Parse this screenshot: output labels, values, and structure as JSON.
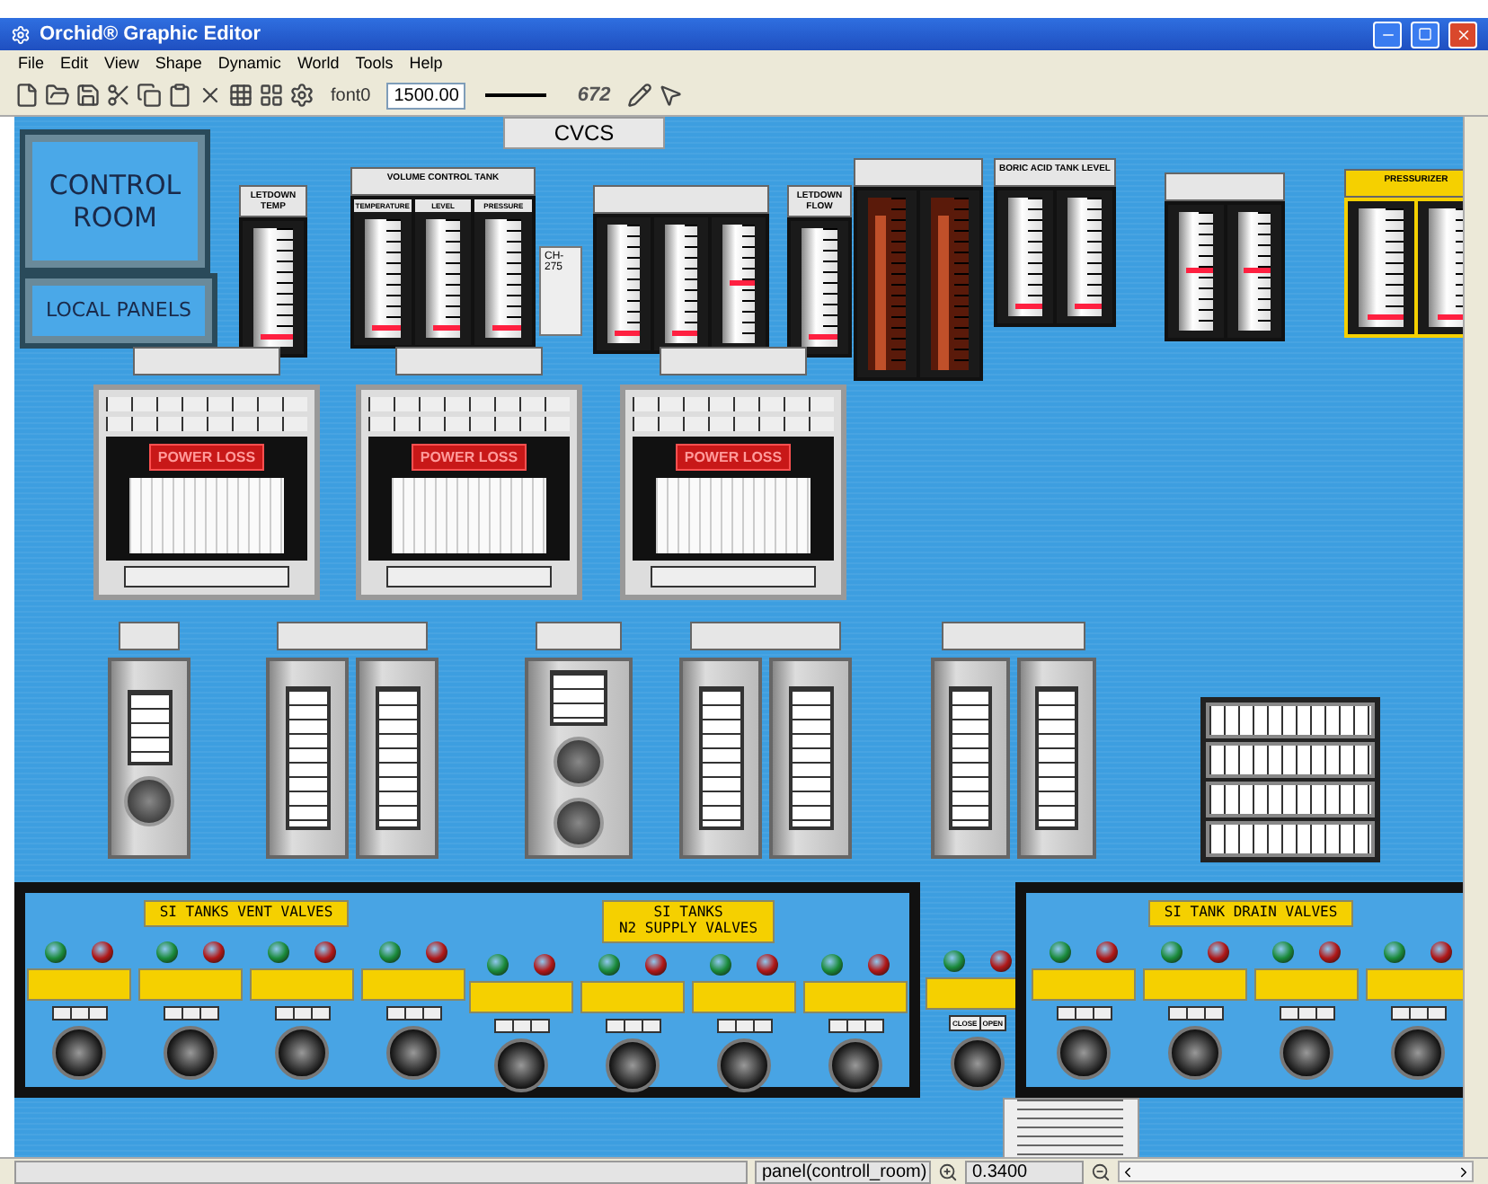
{
  "window": {
    "title": "Orchid® Graphic Editor"
  },
  "menu": [
    "File",
    "Edit",
    "View",
    "Shape",
    "Dynamic",
    "World",
    "Tools",
    "Help"
  ],
  "toolbar": {
    "font": "font0",
    "size": "1500.00",
    "number": "672"
  },
  "canvas": {
    "tab": "CVCS",
    "nav_buttons": [
      "CONTROL ROOM",
      "LOCAL PANELS"
    ],
    "meter_groups": [
      {
        "title": "LETDOWN TEMP",
        "highlight": false,
        "meters": [
          {
            "kind": "vertical",
            "level": 0.08
          }
        ]
      },
      {
        "title": "VOLUME CONTROL TANK",
        "highlight": false,
        "meters": [
          {
            "kind": "vertical",
            "label": "TEMPERATURE",
            "level": 0.08
          },
          {
            "kind": "vertical",
            "label": "LEVEL",
            "level": 0.08
          },
          {
            "kind": "vertical",
            "label": "PRESSURE",
            "level": 0.08
          }
        ]
      },
      {
        "highlight": false,
        "meters": [
          {
            "kind": "vertical",
            "level": 0.08
          },
          {
            "kind": "vertical",
            "level": 0.08
          },
          {
            "kind": "vertical",
            "level": 0.5
          }
        ]
      },
      {
        "title": "LETDOWN FLOW",
        "highlight": false,
        "meters": [
          {
            "kind": "vertical",
            "level": 0.08
          }
        ]
      },
      {
        "highlight": false,
        "meters": [
          {
            "kind": "bar",
            "level": 0.9
          },
          {
            "kind": "bar",
            "level": 0.9
          }
        ]
      },
      {
        "title": "BORIC ACID TANK LEVEL",
        "highlight": false,
        "meters": [
          {
            "kind": "vertical",
            "level": 0.08
          },
          {
            "kind": "vertical",
            "level": 0.08
          }
        ]
      },
      {
        "highlight": false,
        "meters": [
          {
            "kind": "vertical",
            "level": 0.5
          },
          {
            "kind": "vertical",
            "level": 0.5
          }
        ]
      },
      {
        "title": "PRESSURIZER",
        "highlight": true,
        "meters": [
          {
            "kind": "vertical",
            "level": 0.08
          },
          {
            "kind": "vertical",
            "level": 0.08
          }
        ]
      }
    ],
    "note": "CH-275",
    "recorders": [
      {
        "alarm": "POWER LOSS"
      },
      {
        "alarm": "POWER LOSS"
      },
      {
        "alarm": "POWER LOSS"
      }
    ],
    "controllers": [
      {
        "kind": "single"
      },
      {
        "kind": "dual"
      },
      {
        "kind": "knob"
      },
      {
        "kind": "dual"
      },
      {
        "kind": "dual"
      },
      {
        "kind": "ammeter"
      }
    ],
    "valve_panels": [
      {
        "sections": [
          {
            "title": "SI TANKS VENT VALVES",
            "valves": [
              {
                "kind": "three-position"
              },
              {
                "kind": "three-position"
              },
              {
                "kind": "three-position"
              },
              {
                "kind": "three-position"
              }
            ]
          },
          {
            "title": "SI TANKS\nN2 SUPPLY VALVES",
            "valves": [
              {
                "kind": "three-position"
              },
              {
                "kind": "three-position"
              },
              {
                "kind": "three-position"
              },
              {
                "kind": "three-position"
              }
            ]
          }
        ]
      },
      {
        "sections": [
          {
            "valves": [
              {
                "kind": "two-position",
                "positions": [
                  "CLOSE",
                  "OPEN"
                ]
              }
            ]
          }
        ]
      },
      {
        "sections": [
          {
            "title": "SI TANK DRAIN VALVES",
            "valves": [
              {
                "kind": "three-position"
              },
              {
                "kind": "three-position"
              },
              {
                "kind": "three-position"
              },
              {
                "kind": "three-position"
              }
            ]
          }
        ]
      }
    ]
  },
  "status_bar": {
    "panel": "panel(controll_room)",
    "zoom": "0.3400"
  }
}
